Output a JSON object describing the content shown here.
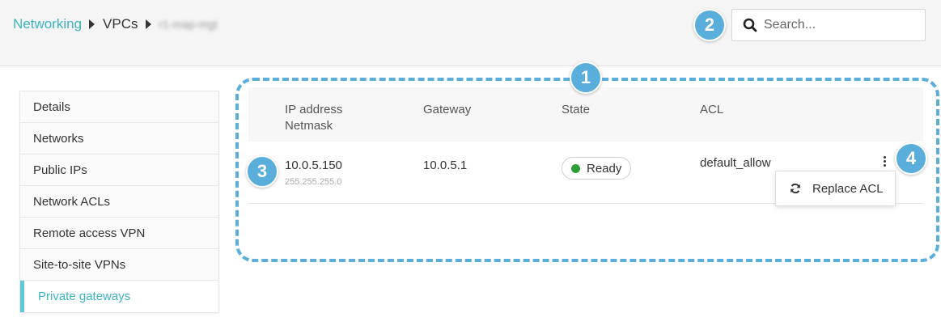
{
  "breadcrumb": {
    "item1": "Networking",
    "item2": "VPCs",
    "item3": "r1-map-mgt"
  },
  "search": {
    "placeholder": "Search..."
  },
  "sidebar": {
    "items": [
      {
        "label": "Details"
      },
      {
        "label": "Networks"
      },
      {
        "label": "Public IPs"
      },
      {
        "label": "Network ACLs"
      },
      {
        "label": "Remote access VPN"
      },
      {
        "label": "Site-to-site VPNs"
      },
      {
        "label": "Private gateways"
      }
    ],
    "active_index": 6
  },
  "table": {
    "headers": {
      "ip_line1": "IP address",
      "ip_line2": "Netmask",
      "gateway": "Gateway",
      "state": "State",
      "acl": "ACL"
    },
    "rows": [
      {
        "ip": "10.0.5.150",
        "netmask": "255.255.255.0",
        "gateway": "10.0.5.1",
        "state": "Ready",
        "acl": "default_allow"
      }
    ]
  },
  "menu": {
    "replace_acl": "Replace ACL",
    "icon": "refresh-icon"
  },
  "callouts": {
    "c1": "1",
    "c2": "2",
    "c3": "3",
    "c4": "4"
  },
  "colors": {
    "accent": "#3bb3c3",
    "callout": "#5aaedc",
    "ready": "#2e9e37"
  }
}
